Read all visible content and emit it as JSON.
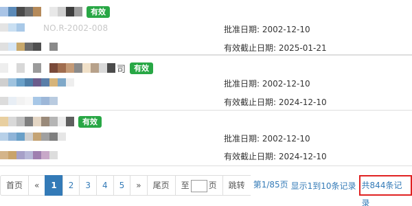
{
  "records": [
    {
      "title_mosaic": [
        "#a9c4e6",
        "#5b8ab8",
        "#4a4a4a",
        "#6f6f6f",
        "#b58a5a",
        "#ffffff",
        "#e8e8e8",
        "#cfcfcf",
        "#3d3d3d",
        "#9c9c9c"
      ],
      "title_suffix": "",
      "status": "有效",
      "line1_mosaic": [
        "#e4e4e4",
        "#c9dff2",
        "#a9c9e8",
        "#ffffff",
        "#ffffff"
      ],
      "line1_text": "NO.R-2002-008",
      "line2_mosaic": [
        "#e0e0e0",
        "#d6e6f5",
        "#c8a86b",
        "#6c6c6c",
        "#4f4f4f",
        "#ffffff",
        "#8a8a8a"
      ],
      "approval_label": "批准日期:",
      "approval_date": "2002-12-10",
      "expiry_label": "有效截止日期:",
      "expiry_date": "2025-01-21"
    },
    {
      "title_mosaic": [
        "#eeeeee",
        "#ffffff",
        "#d8d8d8",
        "#ffffff",
        "#9b9b9b",
        "#ffffff",
        "#7a4a3a",
        "#a06d4f",
        "#c49a76",
        "#8b8b8b",
        "#f0e0c8",
        "#b7a18a",
        "#d9d9d9",
        "#4b4b4b"
      ],
      "title_suffix": "司",
      "status": "有效",
      "line1_mosaic": [
        "#cfcfcf",
        "#9fc3df",
        "#6aa0c8",
        "#4f7fa8",
        "#6c5c8c",
        "#5a7ea8",
        "#d6b47a",
        "#7fa8c8",
        "#eeeeee"
      ],
      "line1_text": "",
      "line2_mosaic": [
        "#dcdcdc",
        "#e8eef5",
        "#f2f2f2",
        "#f7f7f7",
        "#a7c7e7",
        "#9db7d8",
        "#b9cbe0"
      ],
      "approval_label": "批准日期:",
      "approval_date": "2002-12-10",
      "expiry_label": "有效截止日期:",
      "expiry_date": "2024-12-10"
    },
    {
      "title_mosaic": [
        "#e8cfa0",
        "#d9d9d9",
        "#c0c0c0",
        "#7f7f7f",
        "#e4d6c4",
        "#9a8a7a",
        "#b5b5b5",
        "#ececec",
        "#5f5f5f"
      ],
      "title_suffix": "",
      "status": "有效",
      "line1_mosaic": [
        "#b7d0e8",
        "#8fb4d8",
        "#6aa0c8",
        "#d0d0d0",
        "#c4a374",
        "#a0a0a0",
        "#7f7f7f",
        "#e6e6e6"
      ],
      "line1_text": "",
      "line2_mosaic": [
        "#d4b48a",
        "#c9a36b",
        "#a7a0c8",
        "#b8b8d8",
        "#9f7fb0",
        "#c8a8c8",
        "#dddddd"
      ],
      "approval_label": "批准日期:",
      "approval_date": "2002-12-10",
      "expiry_label": "有效截止日期:",
      "expiry_date": "2024-12-10"
    }
  ],
  "pagination": {
    "first": "首页",
    "prev": "«",
    "pages": [
      "1",
      "2",
      "3",
      "4",
      "5"
    ],
    "active_page": "1",
    "next": "»",
    "last": "尾页",
    "goto_prefix": "至",
    "goto_suffix": "页",
    "jump": "跳转",
    "page_info": "第1/85页",
    "range_info": "显示1到10条记录",
    "total_info": "共844条记录"
  },
  "colors": {
    "badge": "#28a745",
    "link": "#337ab7",
    "highlight_border": "#e02020"
  }
}
